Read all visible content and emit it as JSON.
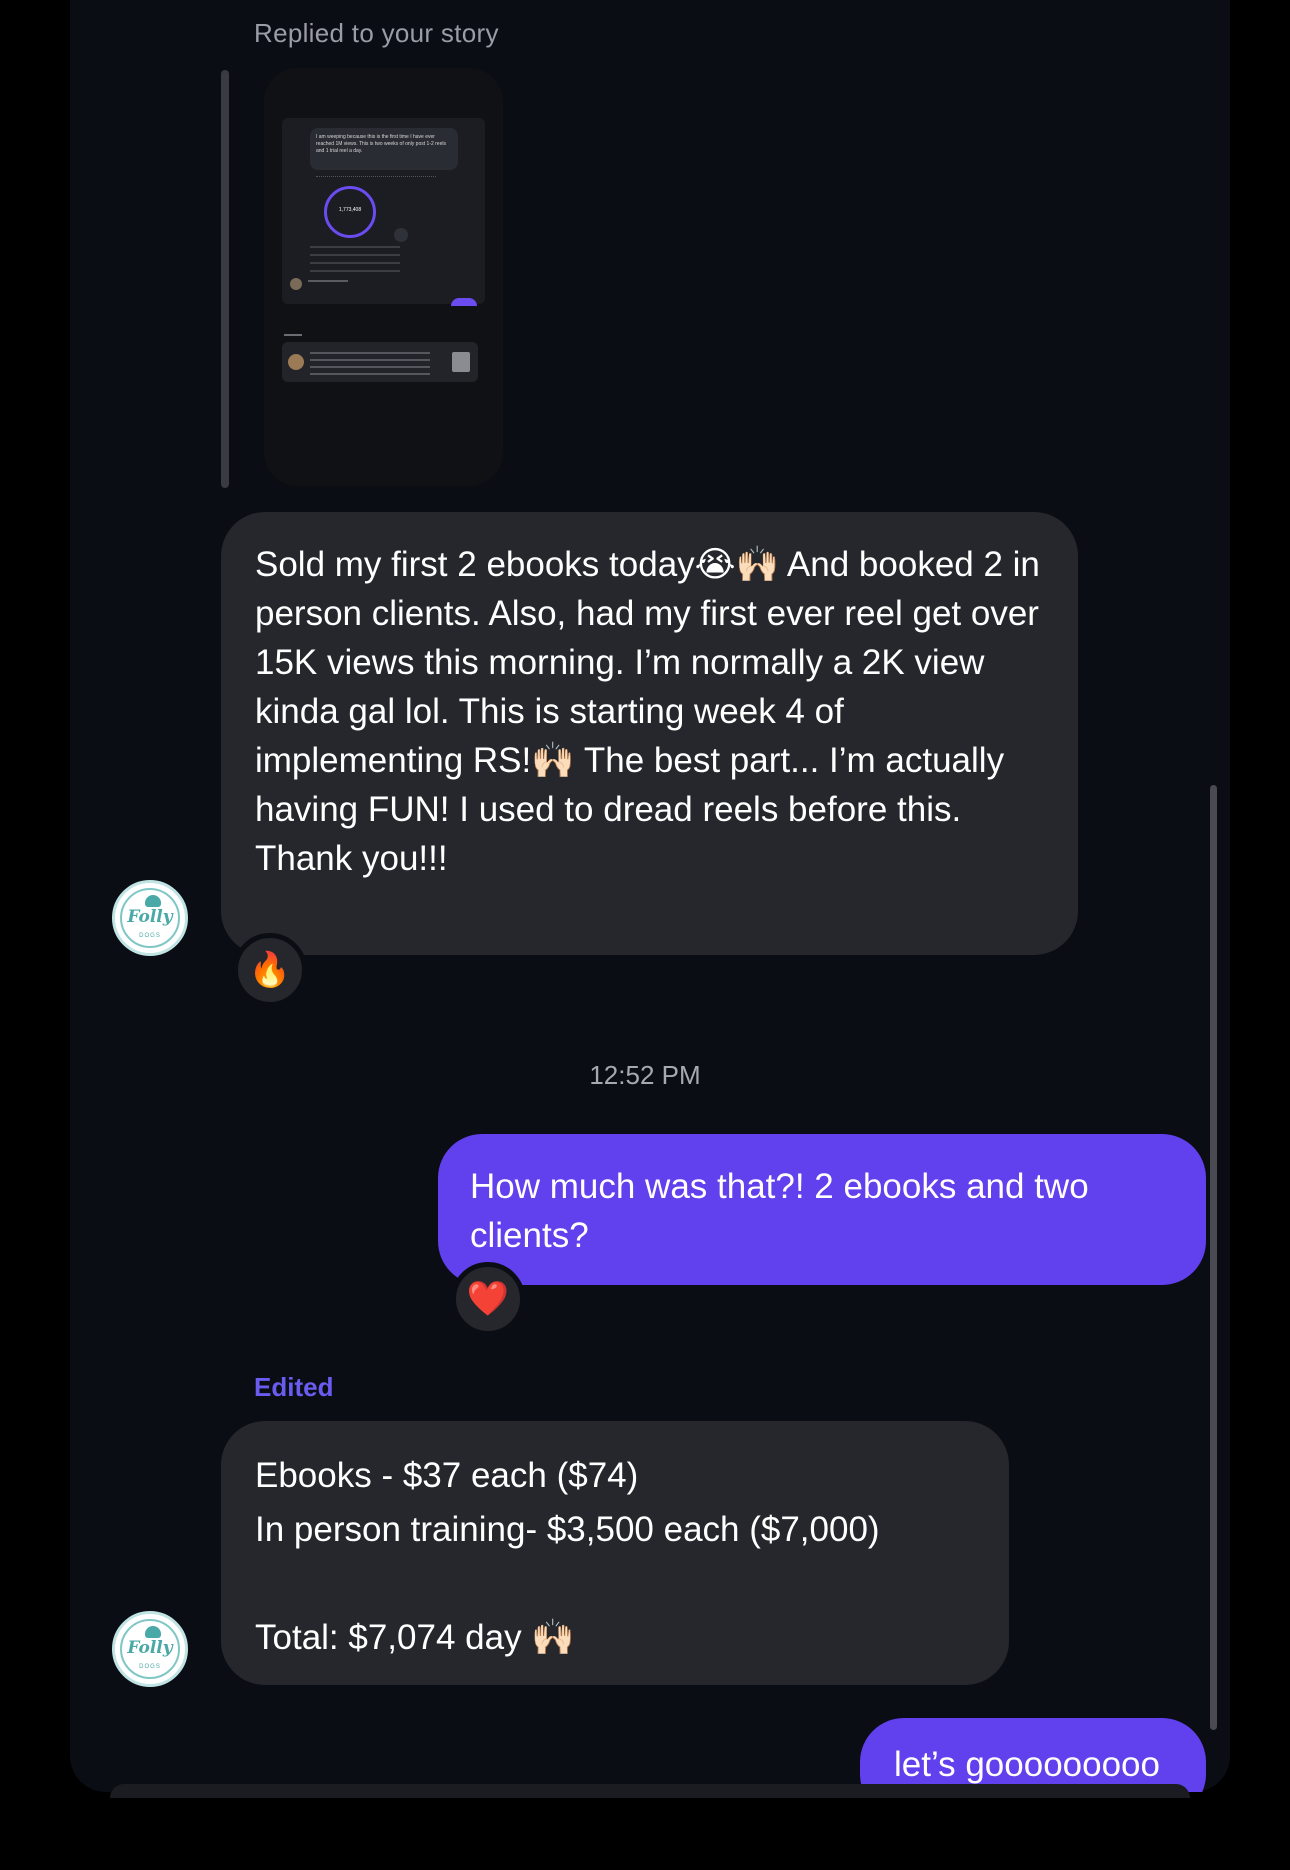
{
  "story_reply": {
    "label": "Replied to your story",
    "caption": "I am weeping because this is the first time I have ever reached 1M views. This is two weeks of only post 1-2 reels and 1 trial reel a day.",
    "ring_value": "1,773,408"
  },
  "messages": {
    "first": {
      "text": "Sold my first 2 ebooks today😭🙌🏻 And booked 2 in person clients. Also, had my first ever reel get over 15K views this morning. I’m normally a 2K view kinda gal lol. This is starting week 4 of implementing RS!🙌🏻 The best part... I’m actually having FUN! I used to dread reels before this. Thank you!!!",
      "reaction": "🔥"
    },
    "timestamp": "12:52 PM",
    "reply": {
      "text": "How much was that?! 2 ebooks and two clients?",
      "reaction": "❤️"
    },
    "edited_label": "Edited",
    "second": {
      "text": "Ebooks - $37 each ($74)\nIn person training- $3,500 each ($7,000)\n\nTotal: $7,074 day 🙌🏻"
    },
    "last_out": {
      "text": "let’s gooooooooo"
    }
  },
  "avatar": {
    "text": "Folly",
    "sub": "DOGS"
  },
  "colors": {
    "background": "#0b0d14",
    "incoming_bubble": "#25272d",
    "outgoing_bubble": "#6140ed",
    "edited": "#6a5cf0"
  }
}
